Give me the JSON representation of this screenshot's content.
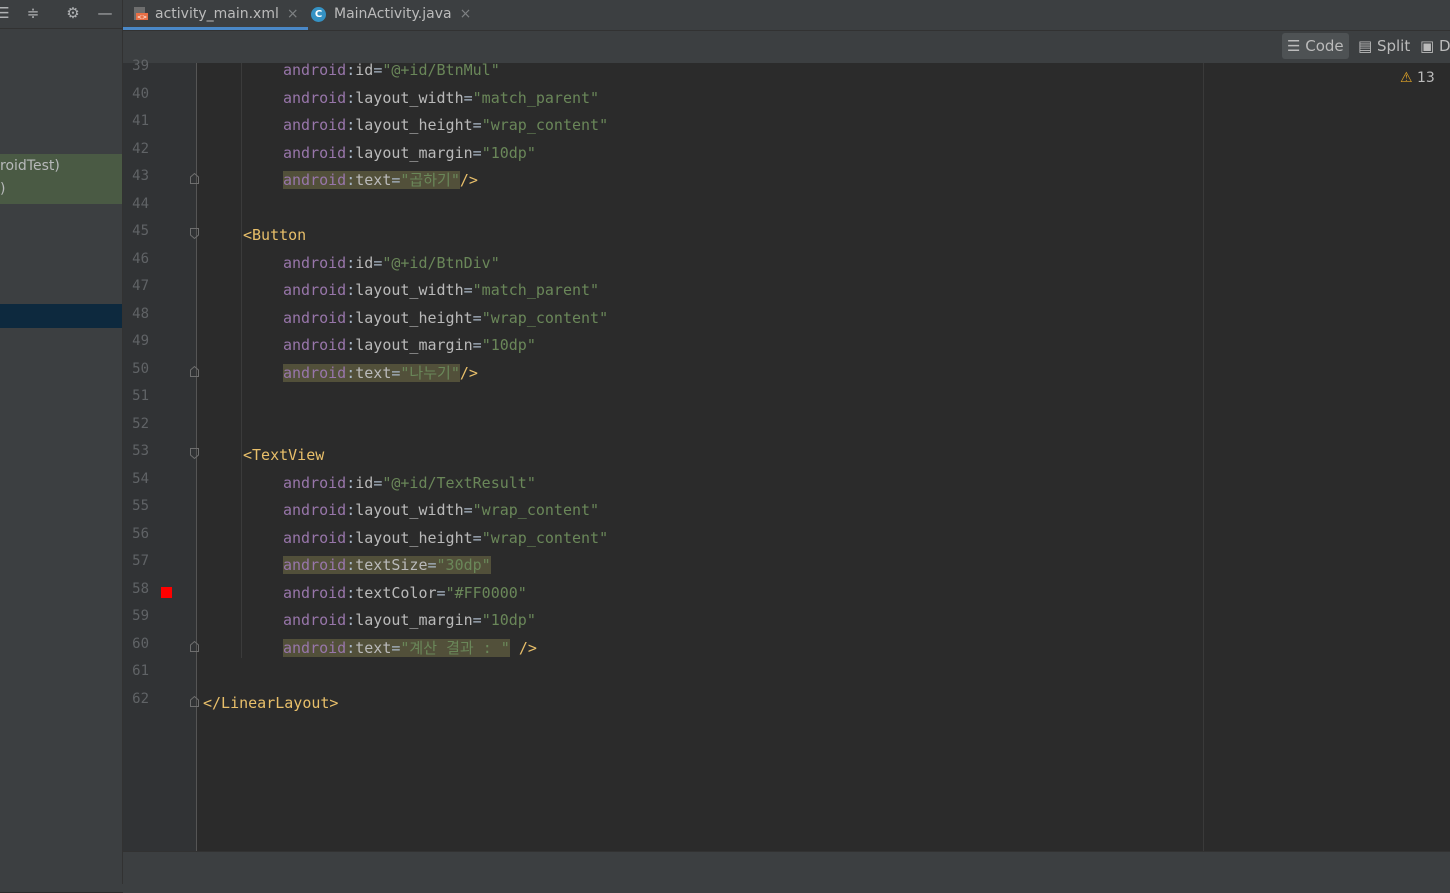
{
  "tabs": [
    {
      "label": "activity_main.xml",
      "icon": "xml-file-icon",
      "active": true
    },
    {
      "label": "MainActivity.java",
      "icon": "java-class-icon",
      "icon_letter": "C",
      "active": false
    }
  ],
  "close_glyph": "×",
  "view_modes": {
    "code": "Code",
    "split": "Split",
    "design": "D"
  },
  "warnings": {
    "count": "13"
  },
  "project_tree": {
    "line1": "roidTest)",
    "line2": ")"
  },
  "code_lines": [
    {
      "num": "39",
      "ns": "android",
      "attr": "id",
      "val": "\"@+id/BtnMul\""
    },
    {
      "num": "40",
      "ns": "android",
      "attr": "layout_width",
      "val": "\"match_parent\""
    },
    {
      "num": "41",
      "ns": "android",
      "attr": "layout_height",
      "val": "\"wrap_content\""
    },
    {
      "num": "42",
      "ns": "android",
      "attr": "layout_margin",
      "val": "\"10dp\""
    },
    {
      "num": "43",
      "ns": "android",
      "attr": "text",
      "val": "\"곱하기\"",
      "end": "/>"
    },
    {
      "num": "44"
    },
    {
      "num": "45",
      "tag": "<Button"
    },
    {
      "num": "46",
      "ns": "android",
      "attr": "id",
      "val": "\"@+id/BtnDiv\""
    },
    {
      "num": "47",
      "ns": "android",
      "attr": "layout_width",
      "val": "\"match_parent\""
    },
    {
      "num": "48",
      "ns": "android",
      "attr": "layout_height",
      "val": "\"wrap_content\""
    },
    {
      "num": "49",
      "ns": "android",
      "attr": "layout_margin",
      "val": "\"10dp\""
    },
    {
      "num": "50",
      "ns": "android",
      "attr": "text",
      "val": "\"나누기\"",
      "end": "/>"
    },
    {
      "num": "51"
    },
    {
      "num": "52"
    },
    {
      "num": "53",
      "tag": "<TextView"
    },
    {
      "num": "54",
      "ns": "android",
      "attr": "id",
      "val": "\"@+id/TextResult\""
    },
    {
      "num": "55",
      "ns": "android",
      "attr": "layout_width",
      "val": "\"wrap_content\""
    },
    {
      "num": "56",
      "ns": "android",
      "attr": "layout_height",
      "val": "\"wrap_content\""
    },
    {
      "num": "57",
      "ns": "android",
      "attr": "textSize",
      "val": "\"30dp\""
    },
    {
      "num": "58",
      "ns": "android",
      "attr": "textColor",
      "val": "\"#FF0000\""
    },
    {
      "num": "59",
      "ns": "android",
      "attr": "layout_margin",
      "val": "\"10dp\""
    },
    {
      "num": "60",
      "ns": "android",
      "attr": "text",
      "val": "\"계산 결과 : \"",
      "end": " />"
    },
    {
      "num": "61"
    },
    {
      "num": "62",
      "tag": "</LinearLayout>"
    }
  ],
  "colors": {
    "accent_tab_underline": "#4a88c7",
    "color_marker": "#FF0000",
    "warning": "#e0a427"
  }
}
